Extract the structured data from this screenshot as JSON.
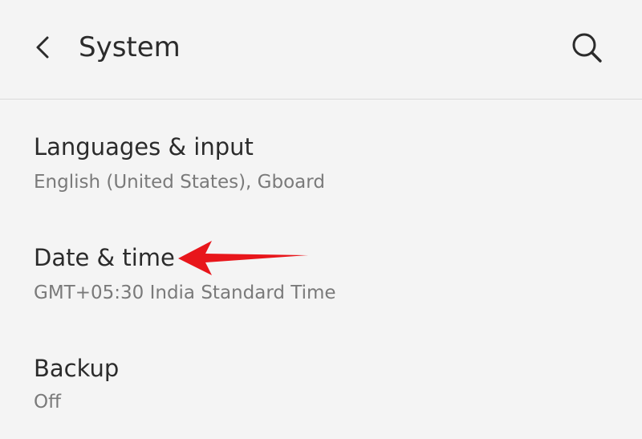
{
  "header": {
    "title": "System"
  },
  "icons": {
    "back": "chevron-left-icon",
    "search": "search-icon"
  },
  "colors": {
    "background": "#f4f4f4",
    "text_primary": "#2b2b2b",
    "text_secondary": "#7a7a7a",
    "divider": "#dadada",
    "annotation_arrow": "#e8161b"
  },
  "settings": [
    {
      "title": "Languages & input",
      "subtitle": "English (United States), Gboard"
    },
    {
      "title": "Date & time",
      "subtitle": "GMT+05:30 India Standard Time"
    },
    {
      "title": "Backup",
      "subtitle": "Off"
    }
  ]
}
